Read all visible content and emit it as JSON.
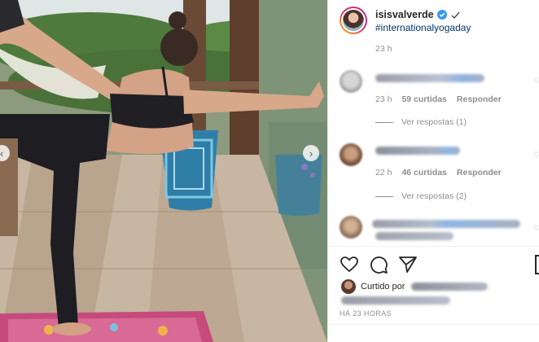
{
  "post": {
    "username": "isisvalverde",
    "caption_hashtag": "#internationalyogaday",
    "time_ago": "23 h",
    "date_label": "HÁ 23 HORAS"
  },
  "comments": [
    {
      "time": "23 h",
      "likes": "59 curtidas",
      "reply": "Responder",
      "view_replies": "Ver respostas (1)"
    },
    {
      "time": "22 h",
      "likes": "46 curtidas",
      "reply": "Responder",
      "view_replies": "Ver respostas (2)"
    }
  ],
  "likes_prefix": "Curtido por",
  "icons": [
    "heart-icon",
    "comment-icon",
    "share-icon",
    "bookmark-icon",
    "verified-badge-icon",
    "check-icon",
    "chevron-left-icon",
    "chevron-right-icon"
  ],
  "colors": {
    "link": "#00376b",
    "muted": "#8e8e8e",
    "text": "#262626",
    "verified": "#3897f0"
  }
}
